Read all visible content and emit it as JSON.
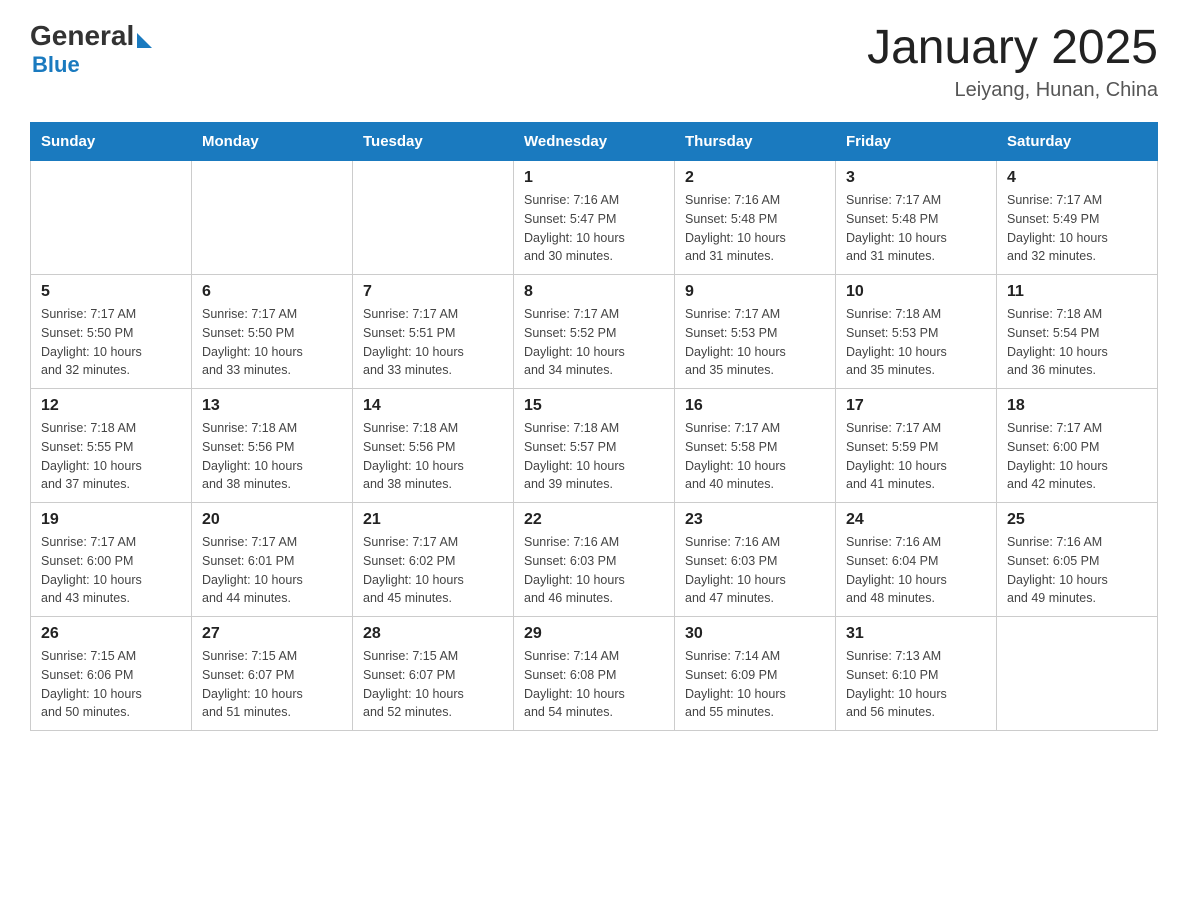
{
  "header": {
    "logo_general": "General",
    "logo_blue": "Blue",
    "title": "January 2025",
    "location": "Leiyang, Hunan, China"
  },
  "days": [
    "Sunday",
    "Monday",
    "Tuesday",
    "Wednesday",
    "Thursday",
    "Friday",
    "Saturday"
  ],
  "weeks": [
    [
      {
        "day": "",
        "info": ""
      },
      {
        "day": "",
        "info": ""
      },
      {
        "day": "",
        "info": ""
      },
      {
        "day": "1",
        "info": "Sunrise: 7:16 AM\nSunset: 5:47 PM\nDaylight: 10 hours\nand 30 minutes."
      },
      {
        "day": "2",
        "info": "Sunrise: 7:16 AM\nSunset: 5:48 PM\nDaylight: 10 hours\nand 31 minutes."
      },
      {
        "day": "3",
        "info": "Sunrise: 7:17 AM\nSunset: 5:48 PM\nDaylight: 10 hours\nand 31 minutes."
      },
      {
        "day": "4",
        "info": "Sunrise: 7:17 AM\nSunset: 5:49 PM\nDaylight: 10 hours\nand 32 minutes."
      }
    ],
    [
      {
        "day": "5",
        "info": "Sunrise: 7:17 AM\nSunset: 5:50 PM\nDaylight: 10 hours\nand 32 minutes."
      },
      {
        "day": "6",
        "info": "Sunrise: 7:17 AM\nSunset: 5:50 PM\nDaylight: 10 hours\nand 33 minutes."
      },
      {
        "day": "7",
        "info": "Sunrise: 7:17 AM\nSunset: 5:51 PM\nDaylight: 10 hours\nand 33 minutes."
      },
      {
        "day": "8",
        "info": "Sunrise: 7:17 AM\nSunset: 5:52 PM\nDaylight: 10 hours\nand 34 minutes."
      },
      {
        "day": "9",
        "info": "Sunrise: 7:17 AM\nSunset: 5:53 PM\nDaylight: 10 hours\nand 35 minutes."
      },
      {
        "day": "10",
        "info": "Sunrise: 7:18 AM\nSunset: 5:53 PM\nDaylight: 10 hours\nand 35 minutes."
      },
      {
        "day": "11",
        "info": "Sunrise: 7:18 AM\nSunset: 5:54 PM\nDaylight: 10 hours\nand 36 minutes."
      }
    ],
    [
      {
        "day": "12",
        "info": "Sunrise: 7:18 AM\nSunset: 5:55 PM\nDaylight: 10 hours\nand 37 minutes."
      },
      {
        "day": "13",
        "info": "Sunrise: 7:18 AM\nSunset: 5:56 PM\nDaylight: 10 hours\nand 38 minutes."
      },
      {
        "day": "14",
        "info": "Sunrise: 7:18 AM\nSunset: 5:56 PM\nDaylight: 10 hours\nand 38 minutes."
      },
      {
        "day": "15",
        "info": "Sunrise: 7:18 AM\nSunset: 5:57 PM\nDaylight: 10 hours\nand 39 minutes."
      },
      {
        "day": "16",
        "info": "Sunrise: 7:17 AM\nSunset: 5:58 PM\nDaylight: 10 hours\nand 40 minutes."
      },
      {
        "day": "17",
        "info": "Sunrise: 7:17 AM\nSunset: 5:59 PM\nDaylight: 10 hours\nand 41 minutes."
      },
      {
        "day": "18",
        "info": "Sunrise: 7:17 AM\nSunset: 6:00 PM\nDaylight: 10 hours\nand 42 minutes."
      }
    ],
    [
      {
        "day": "19",
        "info": "Sunrise: 7:17 AM\nSunset: 6:00 PM\nDaylight: 10 hours\nand 43 minutes."
      },
      {
        "day": "20",
        "info": "Sunrise: 7:17 AM\nSunset: 6:01 PM\nDaylight: 10 hours\nand 44 minutes."
      },
      {
        "day": "21",
        "info": "Sunrise: 7:17 AM\nSunset: 6:02 PM\nDaylight: 10 hours\nand 45 minutes."
      },
      {
        "day": "22",
        "info": "Sunrise: 7:16 AM\nSunset: 6:03 PM\nDaylight: 10 hours\nand 46 minutes."
      },
      {
        "day": "23",
        "info": "Sunrise: 7:16 AM\nSunset: 6:03 PM\nDaylight: 10 hours\nand 47 minutes."
      },
      {
        "day": "24",
        "info": "Sunrise: 7:16 AM\nSunset: 6:04 PM\nDaylight: 10 hours\nand 48 minutes."
      },
      {
        "day": "25",
        "info": "Sunrise: 7:16 AM\nSunset: 6:05 PM\nDaylight: 10 hours\nand 49 minutes."
      }
    ],
    [
      {
        "day": "26",
        "info": "Sunrise: 7:15 AM\nSunset: 6:06 PM\nDaylight: 10 hours\nand 50 minutes."
      },
      {
        "day": "27",
        "info": "Sunrise: 7:15 AM\nSunset: 6:07 PM\nDaylight: 10 hours\nand 51 minutes."
      },
      {
        "day": "28",
        "info": "Sunrise: 7:15 AM\nSunset: 6:07 PM\nDaylight: 10 hours\nand 52 minutes."
      },
      {
        "day": "29",
        "info": "Sunrise: 7:14 AM\nSunset: 6:08 PM\nDaylight: 10 hours\nand 54 minutes."
      },
      {
        "day": "30",
        "info": "Sunrise: 7:14 AM\nSunset: 6:09 PM\nDaylight: 10 hours\nand 55 minutes."
      },
      {
        "day": "31",
        "info": "Sunrise: 7:13 AM\nSunset: 6:10 PM\nDaylight: 10 hours\nand 56 minutes."
      },
      {
        "day": "",
        "info": ""
      }
    ]
  ]
}
